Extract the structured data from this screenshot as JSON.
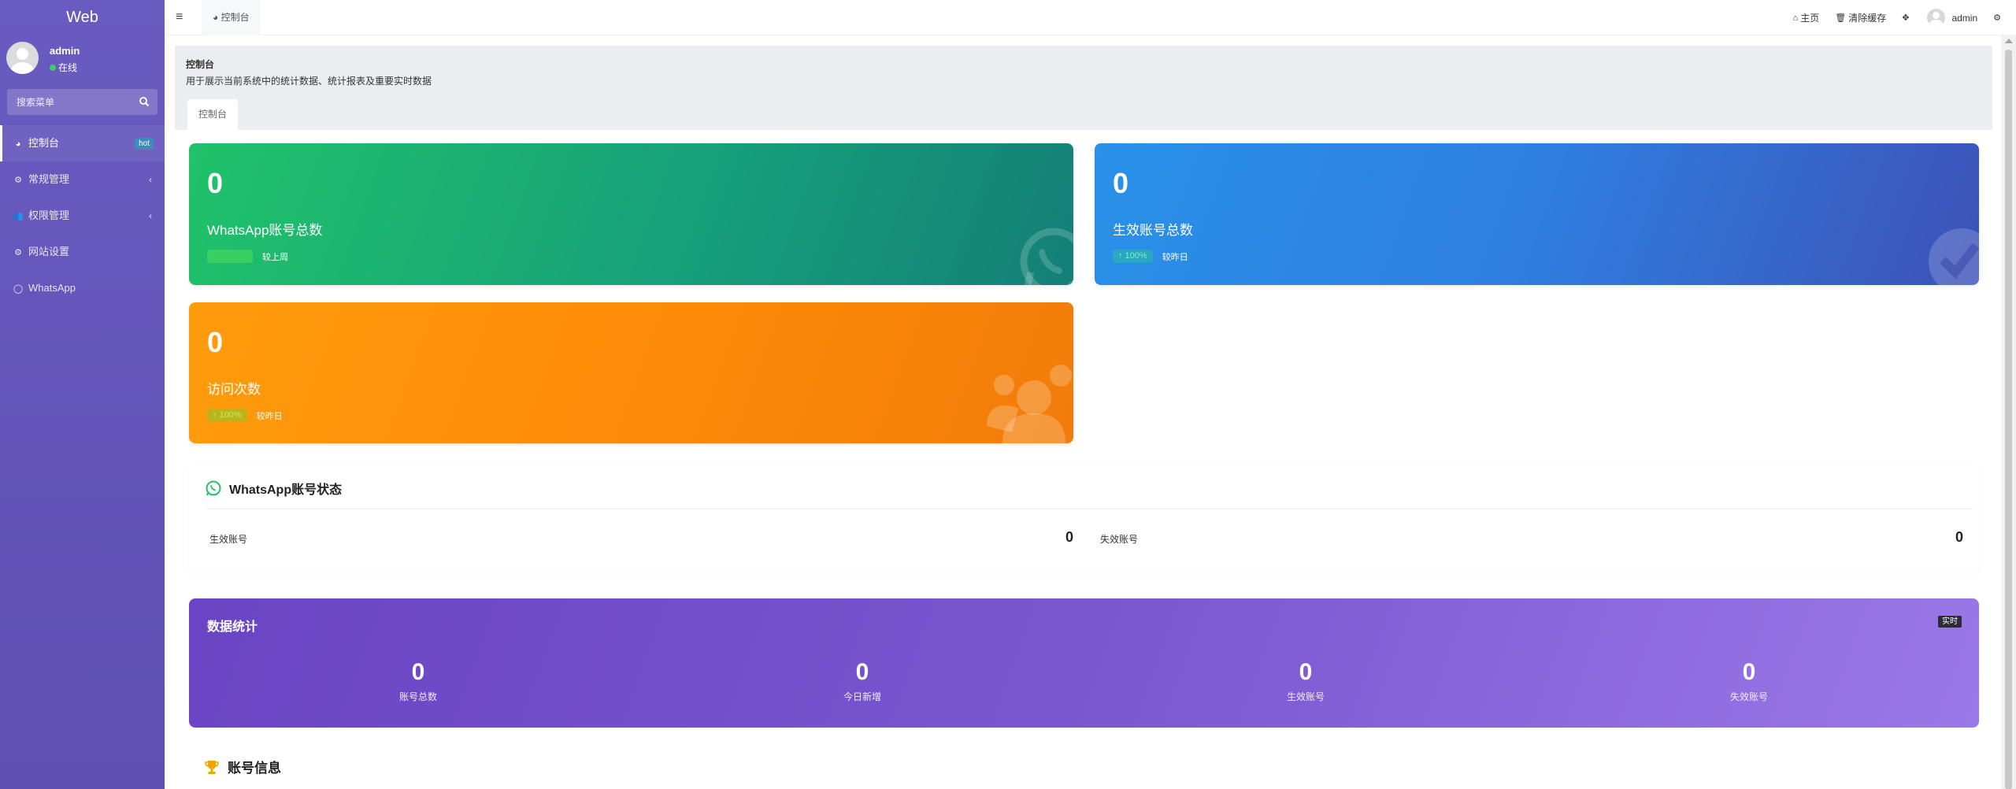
{
  "app": {
    "brand": "Web"
  },
  "user": {
    "name": "admin",
    "status": "在线"
  },
  "sidebar": {
    "search_placeholder": "搜索菜单",
    "items": [
      {
        "label": "控制台",
        "icon": "dashboard-icon",
        "badge": "hot",
        "active": true
      },
      {
        "label": "常规管理",
        "icon": "cogs-icon",
        "has_submenu": true
      },
      {
        "label": "权限管理",
        "icon": "group-icon",
        "has_submenu": true
      },
      {
        "label": "网站设置",
        "icon": "cogs-icon"
      },
      {
        "label": "WhatsApp",
        "icon": "whatsapp-icon"
      }
    ]
  },
  "topbar": {
    "tab_label": "控制台",
    "home_label": "主页",
    "clear_cache_label": "清除缓存",
    "user_label": "admin"
  },
  "header": {
    "title": "控制台",
    "subtitle": "用于展示当前系统中的统计数据、统计报表及重要实时数据",
    "tab_label": "控制台"
  },
  "stats": {
    "whatsapp_total": {
      "value": "0",
      "label": "WhatsApp账号总数",
      "pill": "",
      "compare": "较上周",
      "color": "#20c26a"
    },
    "active_total": {
      "value": "0",
      "label": "生效账号总数",
      "pill": "↑ 100%",
      "compare": "较昨日",
      "color": "#2891e8"
    },
    "visits": {
      "value": "0",
      "label": "访问次数",
      "pill": "↑ 100%",
      "compare": "较昨日",
      "color": "#ff9c0c"
    }
  },
  "wa_status": {
    "title": "WhatsApp账号状态",
    "active_label": "生效账号",
    "active_value": "0",
    "inactive_label": "失效账号",
    "inactive_value": "0"
  },
  "data_stats": {
    "title": "数据统计",
    "badge": "实时",
    "items": [
      {
        "value": "0",
        "label": "账号总数"
      },
      {
        "value": "0",
        "label": "今日新增"
      },
      {
        "value": "0",
        "label": "生效账号"
      },
      {
        "value": "0",
        "label": "失效账号"
      }
    ]
  },
  "account_info": {
    "title": "账号信息"
  }
}
